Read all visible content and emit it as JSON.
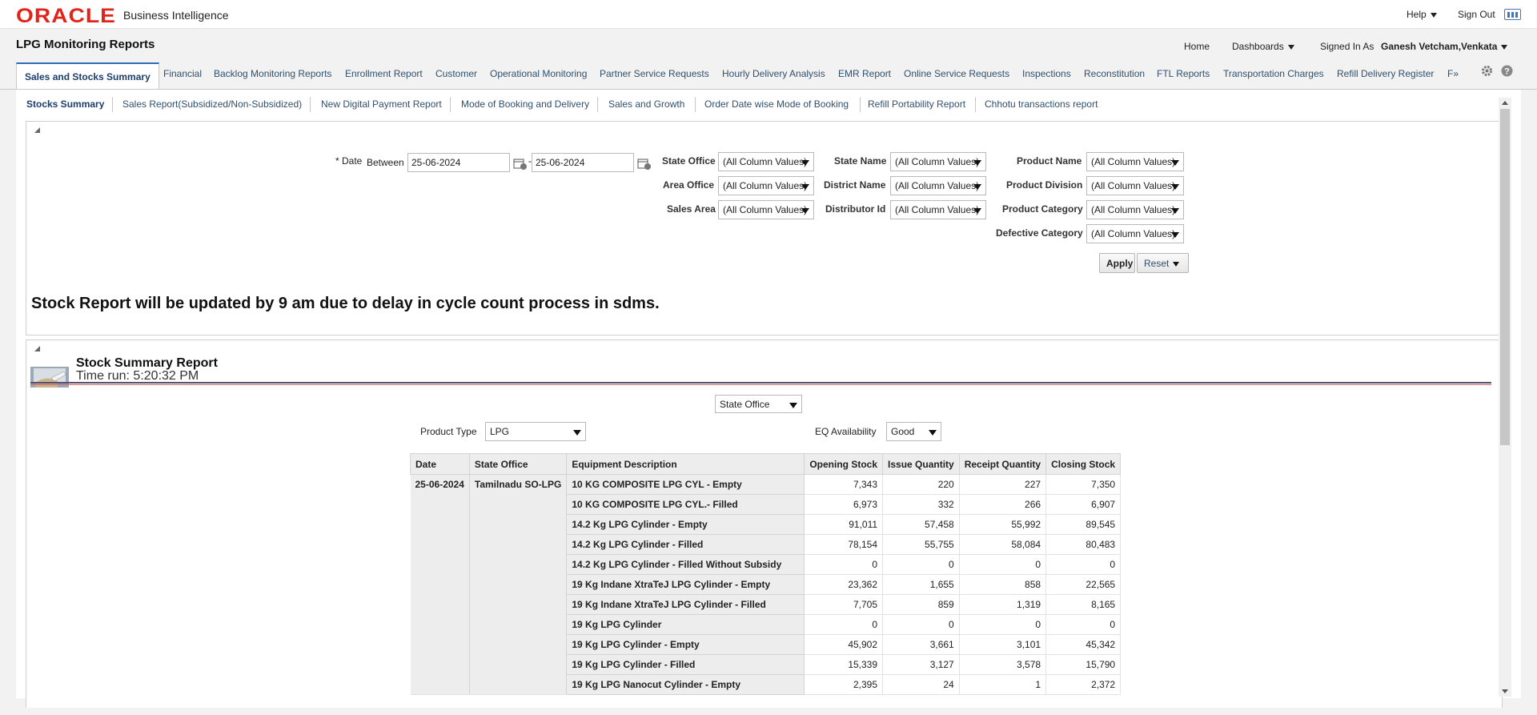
{
  "app": {
    "logo": "ORACLE",
    "product": "Business Intelligence"
  },
  "topbar": {
    "help": "Help",
    "signout": "Sign Out"
  },
  "header": {
    "title": "LPG Monitoring Reports",
    "home": "Home",
    "dashboards": "Dashboards",
    "signed_in_as": "Signed In As",
    "user": "Ganesh Vetcham,Venkata"
  },
  "tabs": [
    "Sales and Stocks Summary",
    "Financial",
    "Backlog Monitoring Reports",
    "Enrollment Report",
    "Customer",
    "Operational Monitoring",
    "Partner Service Requests",
    "Hourly Delivery Analysis",
    "EMR Report",
    "Online Service Requests",
    "Inspections",
    "Reconstitution",
    "FTL Reports",
    "Transportation Charges",
    "Refill Delivery Register"
  ],
  "tabs_more": "F»",
  "subtabs": [
    "Stocks Summary",
    "Sales Report(Subsidized/Non-Subsidized)",
    "New Digital Payment Report",
    "Mode of Booking and Delivery",
    "Sales and Growth",
    "Order Date wise Mode of Booking",
    "Refill Portability Report",
    "Chhotu transactions report"
  ],
  "filters": {
    "date_label": "* Date",
    "between": "Between",
    "date_from": "25-06-2024",
    "date_sep": "-",
    "date_to": "25-06-2024",
    "state_office": "State Office",
    "area_office": "Area Office",
    "sales_area": "Sales Area",
    "state_name": "State Name",
    "district_name": "District Name",
    "distributor_id": "Distributor Id",
    "product_name": "Product Name",
    "product_division": "Product Division",
    "product_category": "Product Category",
    "defective_category": "Defective Category",
    "all_col": "(All Column Values)",
    "apply": "Apply",
    "reset": "Reset"
  },
  "notice": "Stock Report will be updated by 9 am due to delay in cycle count process in sdms.",
  "report": {
    "title": "Stock Summary Report",
    "time_run": "Time run: 5:20:32 PM",
    "view_select": "State Office",
    "product_type_label": "Product Type",
    "product_type": "LPG",
    "eq_label": "EQ Availability",
    "eq_value": "Good",
    "columns": [
      "Date",
      "State Office",
      "Equipment Description",
      "Opening Stock",
      "Issue Quantity",
      "Receipt Quantity",
      "Closing Stock"
    ],
    "date": "25-06-2024",
    "state_office": "Tamilnadu SO-LPG",
    "rows": [
      [
        "10 KG COMPOSITE LPG CYL - Empty",
        "7,343",
        "220",
        "227",
        "7,350"
      ],
      [
        "10 KG COMPOSITE LPG CYL.- Filled",
        "6,973",
        "332",
        "266",
        "6,907"
      ],
      [
        "14.2 Kg LPG Cylinder - Empty",
        "91,011",
        "57,458",
        "55,992",
        "89,545"
      ],
      [
        "14.2 Kg LPG Cylinder - Filled",
        "78,154",
        "55,755",
        "58,084",
        "80,483"
      ],
      [
        "14.2 Kg LPG Cylinder - Filled Without Subsidy",
        "0",
        "0",
        "0",
        "0"
      ],
      [
        "19 Kg Indane XtraTeJ LPG Cylinder - Empty",
        "23,362",
        "1,655",
        "858",
        "22,565"
      ],
      [
        "19 Kg Indane XtraTeJ LPG Cylinder - Filled",
        "7,705",
        "859",
        "1,319",
        "8,165"
      ],
      [
        "19 Kg LPG Cylinder",
        "0",
        "0",
        "0",
        "0"
      ],
      [
        "19 Kg LPG Cylinder - Empty",
        "45,902",
        "3,661",
        "3,101",
        "45,342"
      ],
      [
        "19 Kg LPG Cylinder - Filled",
        "15,339",
        "3,127",
        "3,578",
        "15,790"
      ],
      [
        "19 Kg LPG Nanocut Cylinder - Empty",
        "2,395",
        "24",
        "1",
        "2,372"
      ]
    ]
  }
}
